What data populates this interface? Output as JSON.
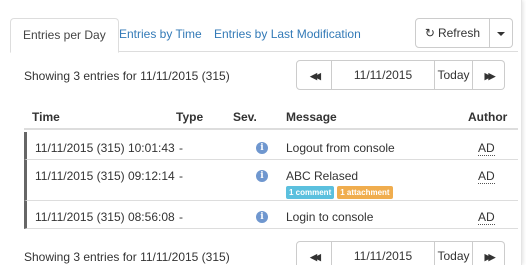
{
  "tabs": [
    "Entries per Day",
    "Entries by Time",
    "Entries by Last Modification"
  ],
  "toolbar": {
    "refresh_label": "Refresh"
  },
  "summary": "Showing 3 entries for 11/11/2015 (315)",
  "pager": {
    "date": "11/11/2015",
    "today_label": "Today"
  },
  "columns": {
    "time": "Time",
    "type": "Type",
    "severity": "Sev.",
    "message": "Message",
    "author": "Author"
  },
  "rows": [
    {
      "time": "11/11/2015 (315) 10:01:43",
      "type": "-",
      "severity": "info",
      "message": "Logout from console",
      "author": "AD"
    },
    {
      "time": "11/11/2015 (315) 09:12:14",
      "type": "-",
      "severity": "info",
      "message": "ABC Relased",
      "author": "AD",
      "badges": [
        "1 comment",
        "1 attachment"
      ]
    },
    {
      "time": "11/11/2015 (315) 08:56:08",
      "type": "-",
      "severity": "info",
      "message": "Login to console",
      "author": "AD"
    }
  ],
  "colors": {
    "link": "#337ab7",
    "comment_badge": "#5bc0de",
    "attachment_badge": "#f0ad4e",
    "info_icon": "#6f97cf",
    "row_marker": "#666666"
  },
  "icons": {
    "refresh": "refresh-icon",
    "prev": "double-chevron-left-icon",
    "next": "double-chevron-right-icon",
    "severity": "info-icon"
  }
}
